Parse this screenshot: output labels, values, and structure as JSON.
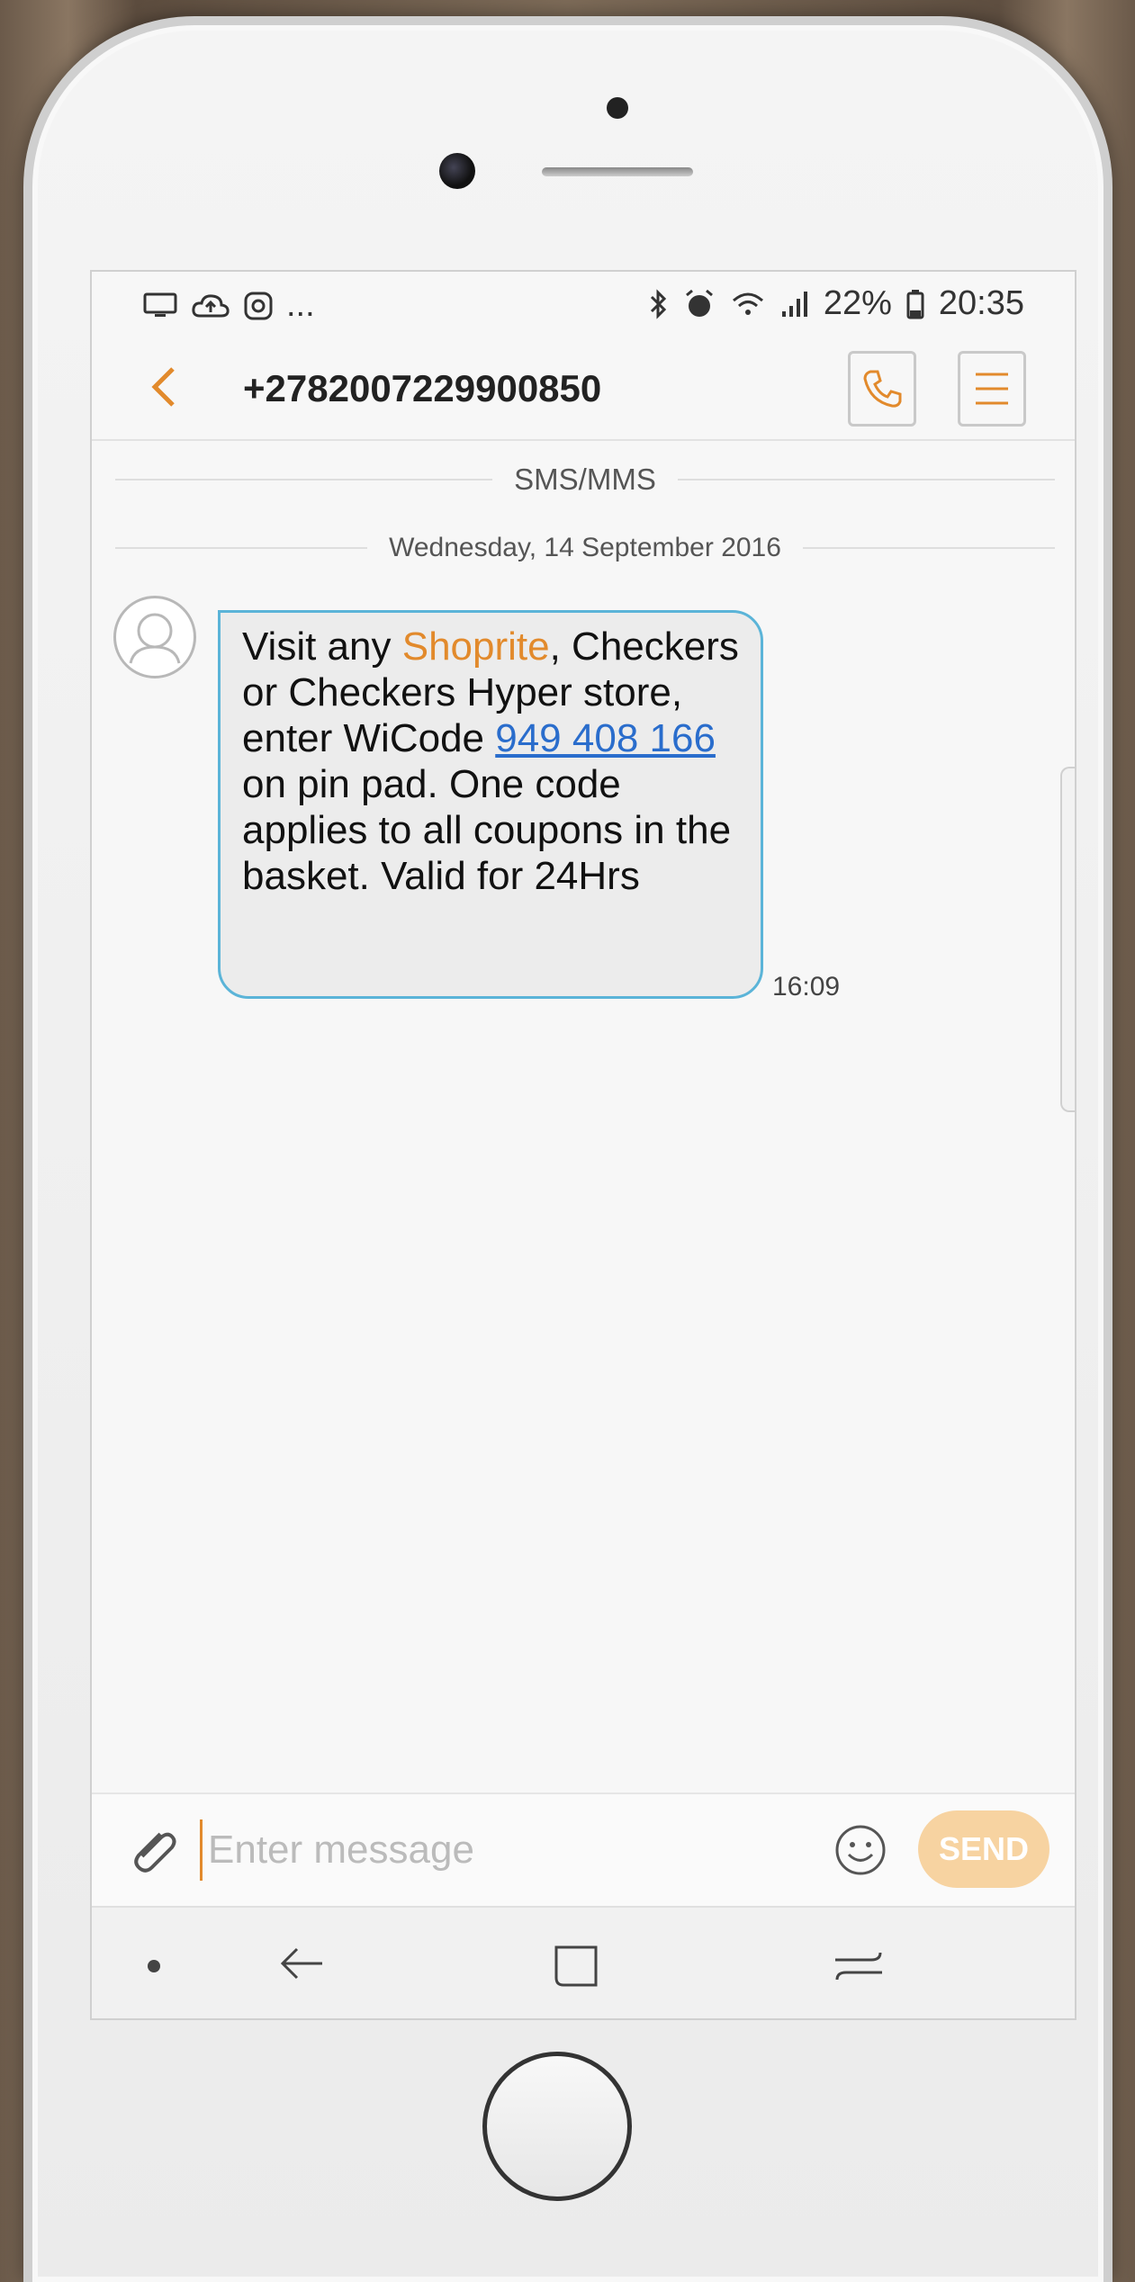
{
  "status": {
    "icons_left": [
      "screen-icon",
      "cloud-upload-icon",
      "instagram-icon"
    ],
    "more": "...",
    "icons_right": [
      "bluetooth-icon",
      "alarm-icon",
      "wifi-icon",
      "signal-icon"
    ],
    "battery": "22%",
    "time": "20:35"
  },
  "header": {
    "contact": "+2782007229900850"
  },
  "thread": {
    "channel_label": "SMS/MMS",
    "date_label": "Wednesday, 14 September 2016"
  },
  "message": {
    "part1": "Visit any ",
    "store": "Shoprite",
    "part2": ", Checkers or Checkers Hyper store, enter WiCode ",
    "code": "949 408 166",
    "part3": " on pin pad. One code applies to all coupons in the basket. Valid for 24Hrs",
    "time": "16:09"
  },
  "composer": {
    "placeholder": "Enter message",
    "send_label": "SEND"
  },
  "colors": {
    "accent": "#e28a2c",
    "link": "#2a6dcc",
    "bubble_border": "#5bb4d8"
  }
}
